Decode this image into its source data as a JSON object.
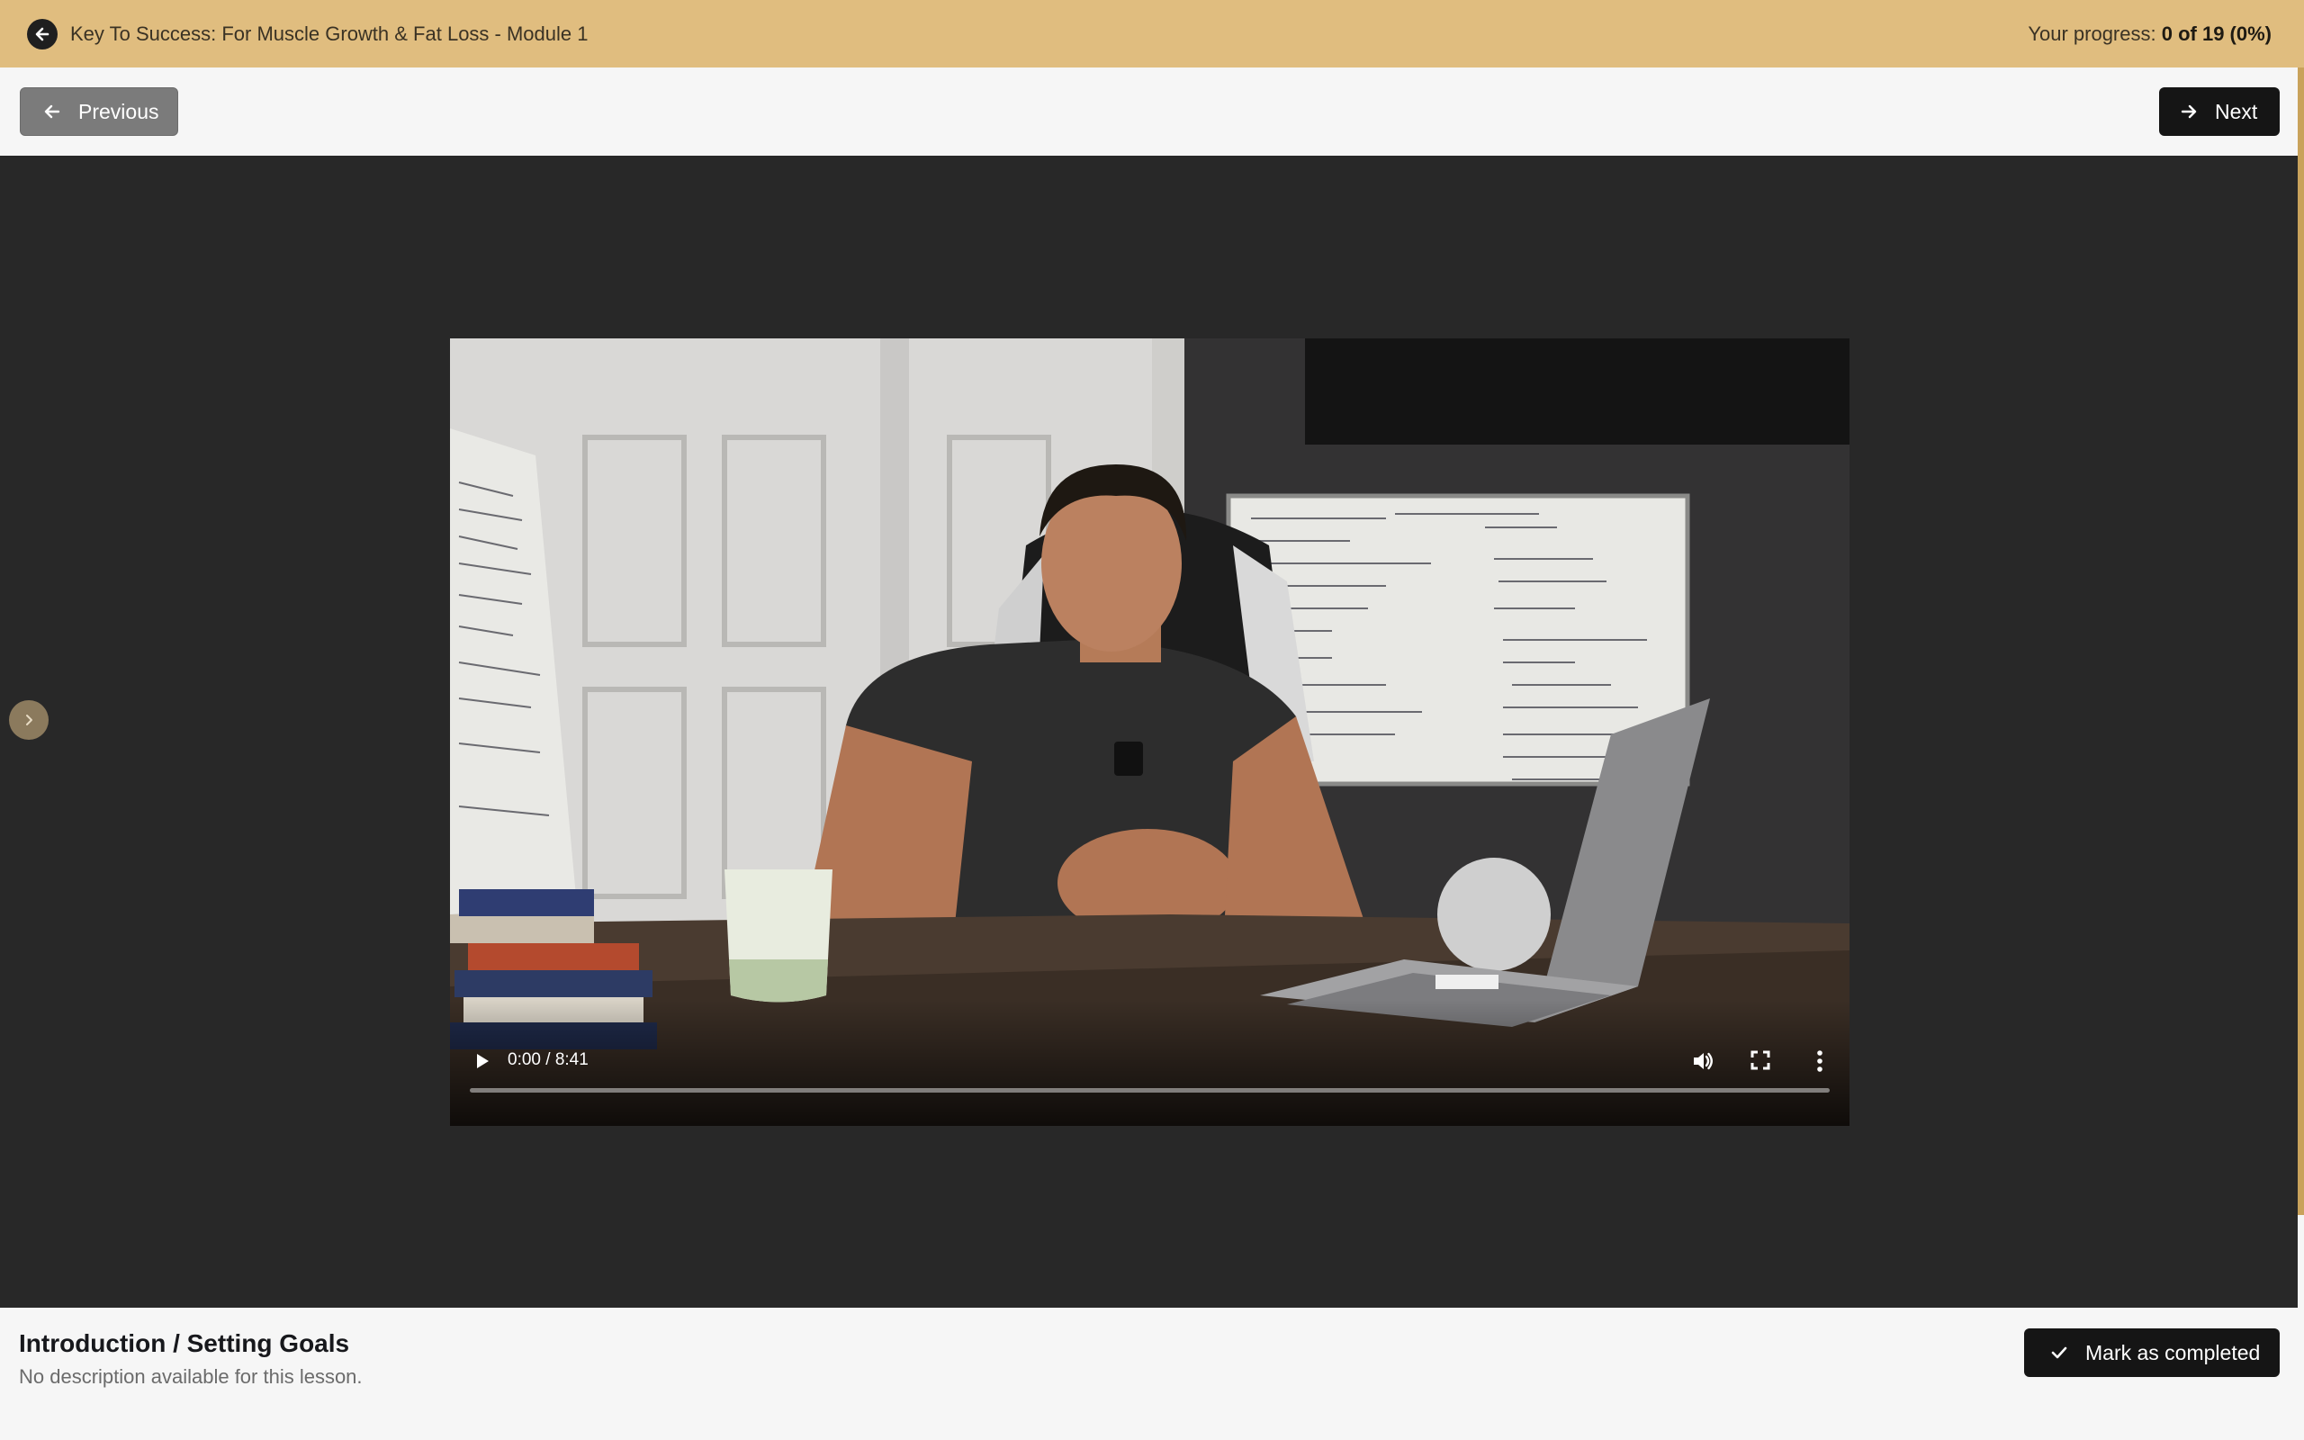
{
  "header": {
    "back_icon": "arrow-left-circle-icon",
    "course_title": "Key To Success: For Muscle Growth & Fat Loss - Module 1",
    "progress_label": "Your progress:",
    "progress_value": "0 of 19 (0%)",
    "progress_completed": 0,
    "progress_total": 19,
    "background_color": "#e0bd7f"
  },
  "nav": {
    "previous_label": "Previous",
    "previous_icon": "arrow-left-icon",
    "next_label": "Next",
    "next_icon": "arrow-right-icon"
  },
  "sidebar_toggle": {
    "icon": "chevron-right-icon"
  },
  "video": {
    "current_time": "0:00",
    "duration": "8:41",
    "time_display": "0:00 / 8:41",
    "played_fraction": 0,
    "play_icon": "play-icon",
    "volume_icon": "volume-icon",
    "fullscreen_icon": "fullscreen-icon",
    "more_icon": "more-vertical-icon"
  },
  "lesson": {
    "title": "Introduction / Setting Goals",
    "description": "No description available for this lesson.",
    "complete_label": "Mark as completed",
    "complete_icon": "check-icon"
  },
  "colors": {
    "accent": "#e0bd7f",
    "stage_background": "#282828",
    "primary_button": "#151515",
    "secondary_button": "#7b7b7b"
  }
}
